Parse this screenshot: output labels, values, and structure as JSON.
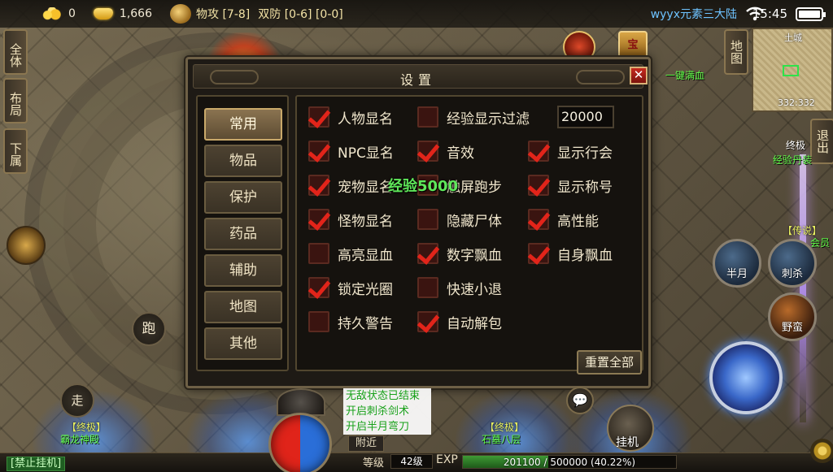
{
  "topbar": {
    "gold": "0",
    "ingot": "1,666",
    "attack": "物攻 [7-8]",
    "defense": "双防 [0-6] [0-0]",
    "server": "wyyx元素三大陆",
    "time": "15:45"
  },
  "left_tabs": [
    "全体",
    "布局",
    "下属"
  ],
  "right_tabs": {
    "map": "地图",
    "exit": "退出"
  },
  "minimap": {
    "city": "土城",
    "coords": "332:332"
  },
  "top_icons": {
    "treasure": "宝",
    "full_hp": "一键满血"
  },
  "dialog": {
    "title": "设置",
    "close": "✕",
    "tabs": [
      "常用",
      "物品",
      "保护",
      "药品",
      "辅助",
      "地图",
      "其他"
    ],
    "active_tab": "常用",
    "exp_filter_value": "20000",
    "options": [
      {
        "label": "人物显名",
        "checked": true
      },
      {
        "label": "经验显示过滤",
        "checked": false
      },
      {
        "label": "NPC显名",
        "checked": true
      },
      {
        "label": "音效",
        "checked": true
      },
      {
        "label": "显示行会",
        "checked": true
      },
      {
        "label": "宠物显名",
        "checked": true
      },
      {
        "label": "触屏跑步",
        "checked": false
      },
      {
        "label": "显示称号",
        "checked": true
      },
      {
        "label": "怪物显名",
        "checked": true
      },
      {
        "label": "隐藏尸体",
        "checked": false
      },
      {
        "label": "高性能",
        "checked": true
      },
      {
        "label": "高亮显血",
        "checked": false
      },
      {
        "label": "数字飘血",
        "checked": true
      },
      {
        "label": "自身飘血",
        "checked": true
      },
      {
        "label": "锁定光圈",
        "checked": true
      },
      {
        "label": "快速小退",
        "checked": false
      },
      {
        "label": "持久警告",
        "checked": false
      },
      {
        "label": "自动解包",
        "checked": true
      }
    ],
    "exp_popup": "经验5000",
    "reset_label": "重置全部"
  },
  "skills": {
    "half_moon": "半月",
    "assassin": "刺杀",
    "wild": "野蛮"
  },
  "controls": {
    "run": "跑",
    "walk": "走",
    "auto": "挂机"
  },
  "players": {
    "left_title": "【终极】",
    "left_name": "霸龙神殿",
    "mid_title": "【终极】",
    "mid_name": "石墓八层",
    "right_title": "【传说】",
    "right_guild": "终极",
    "right_name": "经验丹装",
    "right_member": "会员"
  },
  "chat": [
    "无敌状态已结束",
    "开启刺杀剑术",
    "开启半月弯刀"
  ],
  "bottom": {
    "ban_label": "[禁止挂机]",
    "recent_label": "附近",
    "level_tag": "等级",
    "level": "42级",
    "exp_tag": "EXP",
    "exp_text": "201100 / 500000 (40.22%)",
    "exp_fraction": 0.4022
  },
  "colors": {
    "check": "#e2241a",
    "server": "#6ec3ff",
    "chat": "#18a11a"
  }
}
